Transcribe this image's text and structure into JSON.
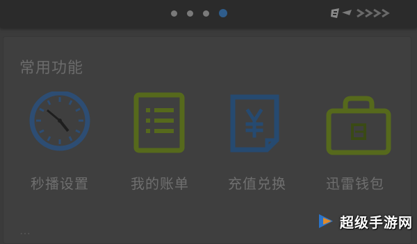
{
  "header": {
    "dots": [
      false,
      false,
      false,
      true
    ],
    "logo": "logo-arrows"
  },
  "section": {
    "title": "常用功能"
  },
  "grid": [
    {
      "icon": "clock-icon",
      "label": "秒播设置"
    },
    {
      "icon": "list-icon",
      "label": "我的账单"
    },
    {
      "icon": "yen-document-icon",
      "label": "充值兑换"
    },
    {
      "icon": "wallet-icon",
      "label": "迅雷钱包"
    }
  ],
  "footer": {
    "faded_text": "…"
  },
  "watermark": {
    "text": "超级手游网",
    "colors": {
      "blue": "#2b74c9",
      "orange": "#e08a2a"
    }
  },
  "colors": {
    "blue": "#2f5d8c",
    "green": "#5a6b1f",
    "bg": "#3b3b3b"
  }
}
